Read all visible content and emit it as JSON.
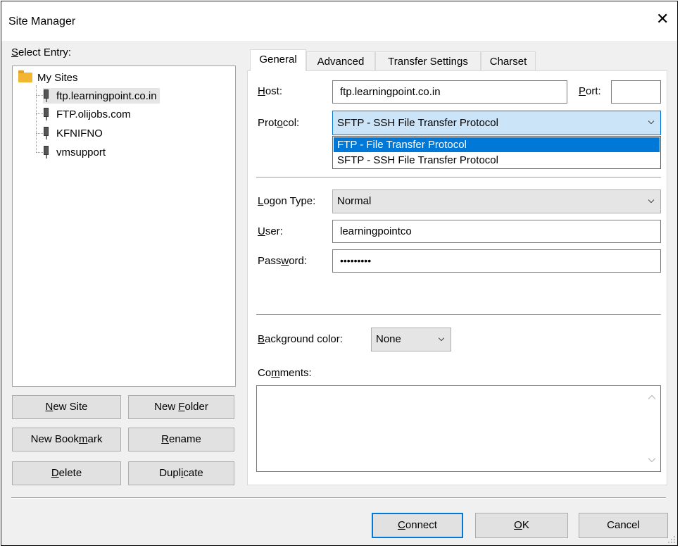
{
  "window": {
    "title": "Site Manager",
    "close_glyph": "✕"
  },
  "left": {
    "select_entry_label": "Select Entry:",
    "root": {
      "label": "My Sites",
      "icon": "folder-icon"
    },
    "sites": [
      {
        "label": "ftp.learningpoint.co.in",
        "selected": true
      },
      {
        "label": "FTP.olijobs.com",
        "selected": false
      },
      {
        "label": "KFNIFNO",
        "selected": false
      },
      {
        "label": "vmsupport",
        "selected": false
      }
    ],
    "buttons": {
      "new_site": "New Site",
      "new_folder": "New Folder",
      "new_bookmark": "New Bookmark",
      "rename": "Rename",
      "delete": "Delete",
      "duplicate": "Duplicate"
    }
  },
  "tabs": [
    "General",
    "Advanced",
    "Transfer Settings",
    "Charset"
  ],
  "general": {
    "host_label": "Host:",
    "host_value": "ftp.learningpoint.co.in",
    "port_label": "Port:",
    "port_value": "",
    "protocol_label": "Protocol:",
    "protocol_value": "SFTP - SSH File Transfer Protocol",
    "protocol_options": [
      "FTP - File Transfer Protocol",
      "SFTP - SSH File Transfer Protocol"
    ],
    "logon_type_label": "Logon Type:",
    "logon_type_value": "Normal",
    "user_label": "User:",
    "user_value": "learningpointco",
    "password_label": "Password:",
    "password_value": "•••••••••",
    "bg_color_label": "Background color:",
    "bg_color_value": "None",
    "comments_label": "Comments:"
  },
  "footer": {
    "connect": "Connect",
    "ok": "OK",
    "cancel": "Cancel"
  },
  "colors": {
    "accent": "#0078d7",
    "folder": "#f2b632",
    "selected_item": "#e5e5e5"
  }
}
